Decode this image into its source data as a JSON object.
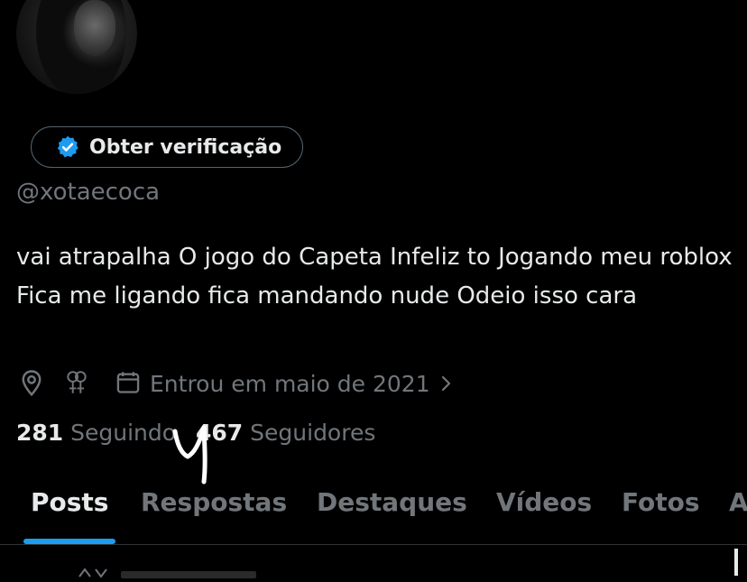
{
  "profile": {
    "verify_button_label": "Obter verificação",
    "handle": "@xotaecoca",
    "bio": "vai atrapalha O jogo do Capeta Infeliz to Jogando meu roblox Fica me ligando fica mandando nude Odeio isso cara",
    "joined": "Entrou em maio de 2021"
  },
  "stats": {
    "following_count": "281",
    "following_label": "Seguindo",
    "followers_count": "467",
    "followers_label": "Seguidores"
  },
  "tabs": [
    {
      "label": "Posts",
      "active": true
    },
    {
      "label": "Respostas",
      "active": false
    },
    {
      "label": "Destaques",
      "active": false
    },
    {
      "label": "Vídeos",
      "active": false
    },
    {
      "label": "Fotos",
      "active": false
    },
    {
      "label": "A",
      "active": false
    }
  ],
  "colors": {
    "background": "#000000",
    "text_primary": "#e7e9ea",
    "text_secondary": "#71767b",
    "accent": "#1d9bf0"
  },
  "icons": [
    "verified-badge-icon",
    "location-pin-icon",
    "gender-symbol-icon",
    "calendar-icon",
    "chevron-right-icon"
  ]
}
